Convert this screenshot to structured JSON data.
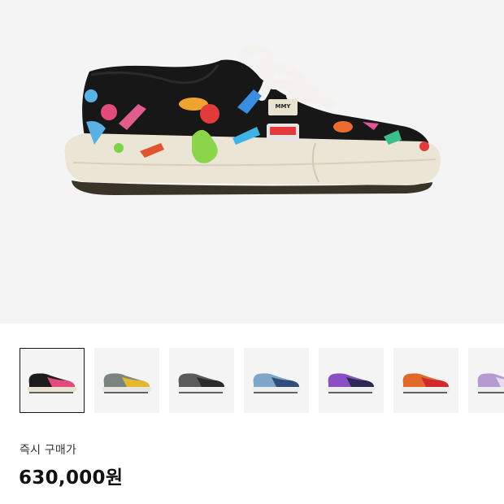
{
  "product": {
    "tag_text": "MMY",
    "colors": {
      "hero_upper": "#171717",
      "hero_sole": "#ebe5d6",
      "hero_laces": "#f4f2ee"
    }
  },
  "thumbnails": [
    {
      "upper": "#1c1c1c",
      "accent": "#e14a7a",
      "sole": "#e8e1d0",
      "selected": true
    },
    {
      "upper": "#7a8580",
      "accent": "#e5b82f",
      "sole": "#e8e6df",
      "selected": false
    },
    {
      "upper": "#5a5a5a",
      "accent": "#2b2b2b",
      "sole": "#efefef",
      "selected": false
    },
    {
      "upper": "#7fa6c9",
      "accent": "#2f4f7a",
      "sole": "#eeeeee",
      "selected": false
    },
    {
      "upper": "#8a4fc2",
      "accent": "#2b2a52",
      "sole": "#eeeeee",
      "selected": false
    },
    {
      "upper": "#e0692b",
      "accent": "#d12a2a",
      "sole": "#eeeeee",
      "selected": false
    },
    {
      "upper": "#b49ad0",
      "accent": "#e9dcf0",
      "sole": "#eeeeee",
      "selected": false
    }
  ],
  "purchase": {
    "label": "즉시 구매가",
    "price": "630,000원"
  }
}
